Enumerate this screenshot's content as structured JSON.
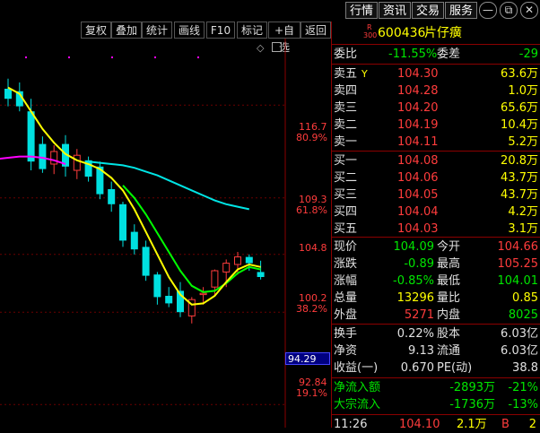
{
  "topbar": {
    "tabs": [
      "行情",
      "资讯",
      "交易",
      "服务"
    ],
    "window": {
      "minimize": "—",
      "restore": "⧉",
      "close": "✕"
    }
  },
  "toolbar": {
    "buttons": [
      "复权",
      "叠加",
      "统计",
      "画线",
      "F10",
      "标记",
      "+自选",
      "返回"
    ]
  },
  "stock": {
    "badge_top": "R",
    "badge_bottom": "300",
    "code": "600436",
    "name": "片仔癀"
  },
  "chart": {
    "price_labels": [
      "116.7",
      "109.3",
      "104.8",
      "100.2",
      "94.29",
      "92.84"
    ],
    "pct_labels": [
      "80.9%",
      "61.8%",
      "38.2%",
      "19.1%"
    ],
    "current_price_box": "94.29",
    "colors": {
      "up": "#ff3c3c",
      "down": "#00e0e0",
      "ma5": "#ffff00",
      "ma10": "#00ff00",
      "ma20": "#ff00ff",
      "ma30": "#00e5e5"
    }
  },
  "chart_data": {
    "type": "candlestick",
    "ylim": [
      91.0,
      122.0
    ],
    "candles": [
      {
        "o": 118.0,
        "h": 118.8,
        "l": 116.6,
        "c": 117.2
      },
      {
        "o": 117.8,
        "h": 118.5,
        "l": 116.2,
        "c": 116.6
      },
      {
        "o": 116.2,
        "h": 117.2,
        "l": 111.5,
        "c": 112.2
      },
      {
        "o": 113.6,
        "h": 114.2,
        "l": 111.3,
        "c": 111.6
      },
      {
        "o": 112.0,
        "h": 113.5,
        "l": 111.2,
        "c": 113.0
      },
      {
        "o": 113.6,
        "h": 114.3,
        "l": 111.0,
        "c": 111.8
      },
      {
        "o": 111.5,
        "h": 113.2,
        "l": 110.8,
        "c": 112.7
      },
      {
        "o": 112.3,
        "h": 112.6,
        "l": 110.6,
        "c": 111.0
      },
      {
        "o": 111.8,
        "h": 112.2,
        "l": 109.2,
        "c": 109.6
      },
      {
        "o": 110.0,
        "h": 110.6,
        "l": 108.2,
        "c": 108.8
      },
      {
        "o": 108.8,
        "h": 109.0,
        "l": 105.4,
        "c": 105.9
      },
      {
        "o": 106.6,
        "h": 107.2,
        "l": 104.8,
        "c": 105.2
      },
      {
        "o": 105.4,
        "h": 105.9,
        "l": 102.7,
        "c": 103.1
      },
      {
        "o": 103.2,
        "h": 103.4,
        "l": 100.8,
        "c": 101.4
      },
      {
        "o": 101.5,
        "h": 102.2,
        "l": 100.6,
        "c": 100.9
      },
      {
        "o": 101.9,
        "h": 102.6,
        "l": 99.8,
        "c": 100.2
      },
      {
        "o": 99.9,
        "h": 101.4,
        "l": 99.3,
        "c": 101.2
      },
      {
        "o": 101.6,
        "h": 102.2,
        "l": 100.8,
        "c": 101.7
      },
      {
        "o": 102.2,
        "h": 103.6,
        "l": 101.5,
        "c": 103.5
      },
      {
        "o": 103.4,
        "h": 104.4,
        "l": 102.2,
        "c": 104.1
      },
      {
        "o": 104.0,
        "h": 105.0,
        "l": 103.2,
        "c": 104.6
      },
      {
        "o": 104.6,
        "h": 104.8,
        "l": 103.5,
        "c": 104.1
      },
      {
        "o": 103.4,
        "h": 104.3,
        "l": 102.8,
        "c": 103.0
      }
    ],
    "ma_yellow": [
      118.1,
      117.6,
      116.2,
      114.8,
      113.7,
      112.8,
      112.3,
      112.0,
      111.6,
      110.9,
      109.9,
      108.4,
      106.6,
      104.8,
      103.0,
      101.6,
      100.8,
      100.9,
      101.5,
      102.6,
      103.6,
      104.0,
      103.8
    ],
    "ma_green": [
      null,
      null,
      null,
      null,
      null,
      null,
      null,
      null,
      null,
      null,
      110.3,
      109.3,
      108.0,
      106.5,
      105.0,
      103.5,
      102.3,
      101.8,
      101.9,
      102.5,
      103.3,
      103.8,
      103.6
    ],
    "ma_magenta": [
      112.4,
      112.5,
      112.6,
      112.6,
      112.5,
      112.3,
      112.0
    ],
    "ma_cyan": [
      112.2,
      112.1,
      112.0,
      111.9,
      111.7,
      111.4,
      111.1,
      110.7,
      110.3,
      109.9,
      109.5,
      109.1,
      108.8,
      108.6,
      108.4
    ]
  },
  "quote": {
    "weibi_label": "委比",
    "weibi_value": "-11.55%",
    "weicha_label": "委差",
    "weicha_value": "-29",
    "asks": [
      {
        "label": "卖五",
        "mark": "Y",
        "price": "104.30",
        "vol": "63.6万"
      },
      {
        "label": "卖四",
        "mark": "",
        "price": "104.28",
        "vol": "1.0万"
      },
      {
        "label": "卖三",
        "mark": "",
        "price": "104.20",
        "vol": "65.6万"
      },
      {
        "label": "卖二",
        "mark": "",
        "price": "104.19",
        "vol": "10.4万"
      },
      {
        "label": "卖一",
        "mark": "",
        "price": "104.11",
        "vol": "5.2万"
      }
    ],
    "bids": [
      {
        "label": "买一",
        "price": "104.08",
        "vol": "20.8万"
      },
      {
        "label": "买二",
        "price": "104.06",
        "vol": "43.7万"
      },
      {
        "label": "买三",
        "price": "104.05",
        "vol": "43.7万"
      },
      {
        "label": "买四",
        "price": "104.04",
        "vol": "4.2万"
      },
      {
        "label": "买五",
        "price": "104.03",
        "vol": "3.1万"
      }
    ],
    "stats": [
      {
        "l1": "现价",
        "v1": "104.09",
        "c1": "green",
        "l2": "今开",
        "v2": "104.66",
        "c2": "red"
      },
      {
        "l1": "涨跌",
        "v1": "-0.89",
        "c1": "green",
        "l2": "最高",
        "v2": "105.25",
        "c2": "red"
      },
      {
        "l1": "涨幅",
        "v1": "-0.85%",
        "c1": "green",
        "l2": "最低",
        "v2": "104.01",
        "c2": "green"
      },
      {
        "l1": "总量",
        "v1": "13296",
        "c1": "yellow",
        "l2": "量比",
        "v2": "0.85",
        "c2": "yellow"
      },
      {
        "l1": "外盘",
        "v1": "5271",
        "c1": "red",
        "l2": "内盘",
        "v2": "8025",
        "c2": "green"
      }
    ],
    "fin": [
      {
        "l1": "换手",
        "v1": "0.22%",
        "l2": "股本",
        "v2": "6.03亿"
      },
      {
        "l1": "净资",
        "v1": "9.13",
        "l2": "流通",
        "v2": "6.03亿"
      },
      {
        "l1": "收益(一)",
        "v1": "0.670",
        "l2": "PE(动)",
        "v2": "38.8"
      }
    ],
    "flows": [
      {
        "label": "净流入额",
        "v1": "-2893万",
        "v2": "-21%"
      },
      {
        "label": "大宗流入",
        "v1": "-1736万",
        "v2": "-13%"
      }
    ],
    "tick": {
      "time": "11:26",
      "price": "104.10",
      "vol": "2.1万",
      "bs": "B",
      "num": "2"
    }
  }
}
